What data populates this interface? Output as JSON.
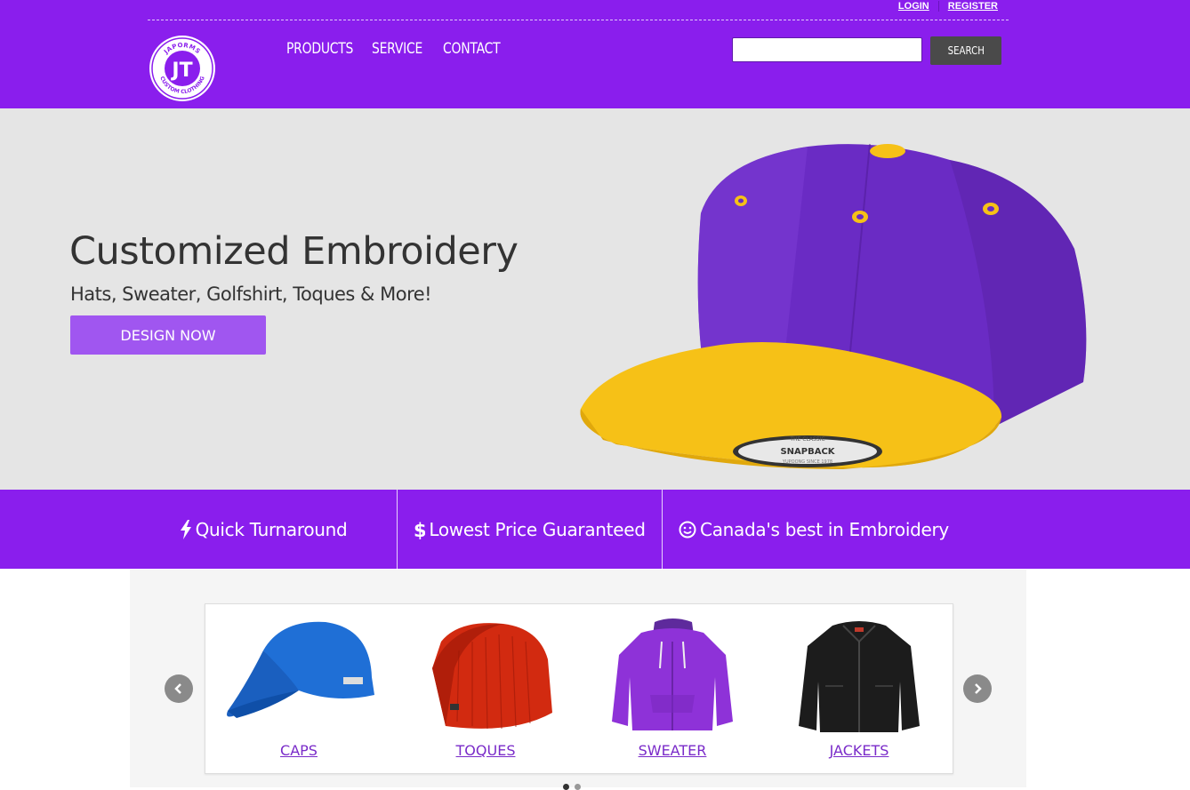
{
  "header": {
    "top_links": {
      "login": "LOGIN",
      "register": "REGISTER"
    },
    "logo": {
      "text_top": "JAPORMS",
      "text_bottom": "CUSTOM CLOTHING",
      "monogram": "JT"
    },
    "nav": [
      {
        "label": "PRODUCTS"
      },
      {
        "label": "SERVICE"
      },
      {
        "label": "CONTACT"
      }
    ],
    "search": {
      "placeholder": "",
      "value": "",
      "button_label": "SEARCH"
    }
  },
  "hero": {
    "title": "Customized Embroidery",
    "subtitle": "Hats, Sweater, Golfshirt, Toques & More!",
    "cta_label": "DESIGN NOW",
    "cap_badge_top": "THE CLASSIC",
    "cap_badge_main": "SNAPBACK",
    "cap_badge_bottom": "YUPOONG SINCE 1978"
  },
  "features": [
    {
      "icon": "bolt-icon",
      "label": "Quick Turnaround"
    },
    {
      "icon": "dollar-icon",
      "label": "Lowest Price Guaranteed"
    },
    {
      "icon": "smile-icon",
      "label": "Canada's best in Embroidery"
    }
  ],
  "products": [
    {
      "label": "CAPS"
    },
    {
      "label": "TOQUES"
    },
    {
      "label": "SWEATER"
    },
    {
      "label": "JACKETS"
    }
  ],
  "colors": {
    "brand_purple": "#8a1eed",
    "hero_bg": "#e5e5e5",
    "cta_purple": "#a056f0",
    "cap_purple": "#6a2bc4",
    "cap_yellow": "#f6c117",
    "link_purple": "#7a2bc9"
  }
}
